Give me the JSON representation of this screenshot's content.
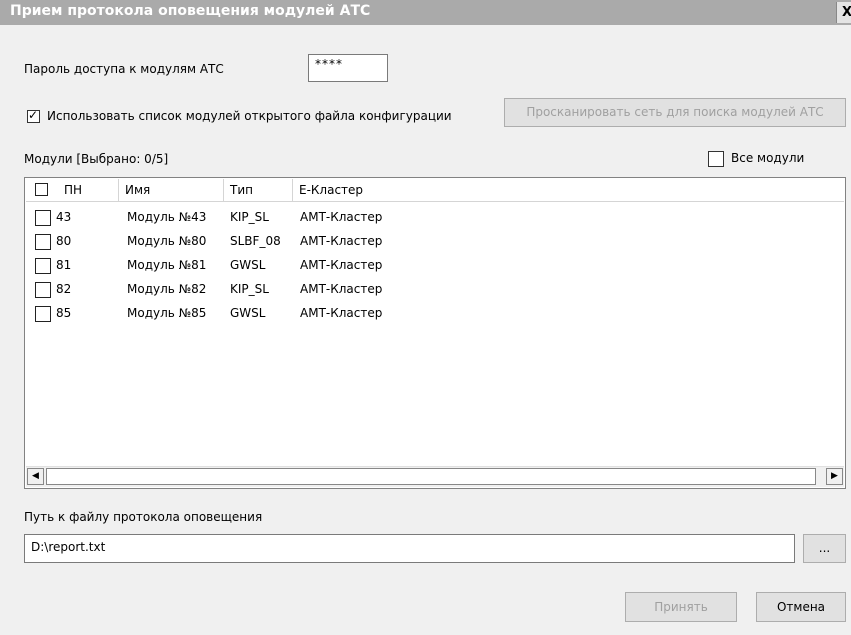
{
  "window": {
    "title": "Прием протокола  оповещения модулей АТС",
    "close_label": "X"
  },
  "password": {
    "label": "Пароль доступа к модулям АТС",
    "value": "****"
  },
  "use_config": {
    "label": "Использовать список модулей открытого файла конфигурации",
    "checked": true
  },
  "scan_button": {
    "label": "Просканировать сеть для поиска модулей АТС"
  },
  "modules": {
    "summary": "Модули [Выбрано: 0/5]",
    "all_label": "Все модули",
    "columns": [
      "ПН",
      "Имя",
      "Тип",
      "Е-Кластер"
    ],
    "rows": [
      {
        "pn": "43",
        "name": "Модуль №43",
        "type": "KIP_SL",
        "cluster": "АМТ-Кластер"
      },
      {
        "pn": "80",
        "name": "Модуль №80",
        "type": "SLBF_08",
        "cluster": "АМТ-Кластер"
      },
      {
        "pn": "81",
        "name": "Модуль №81",
        "type": "GWSL",
        "cluster": "АМТ-Кластер"
      },
      {
        "pn": "82",
        "name": "Модуль №82",
        "type": "KIP_SL",
        "cluster": "АМТ-Кластер"
      },
      {
        "pn": "85",
        "name": "Модуль №85",
        "type": "GWSL",
        "cluster": "АМТ-Кластер"
      }
    ]
  },
  "report_path": {
    "label": "Путь к файлу протокола оповещения",
    "value": "D:\\report.txt",
    "browse_label": "..."
  },
  "footer": {
    "accept_label": "Принять",
    "cancel_label": "Отмена"
  }
}
